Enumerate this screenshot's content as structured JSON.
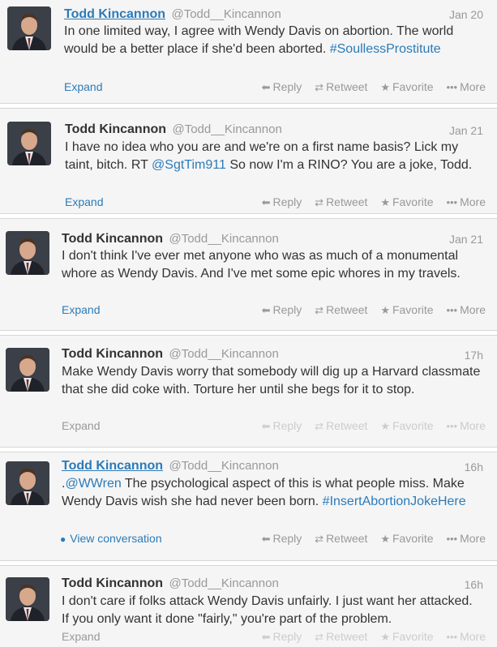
{
  "tweets": [
    {
      "name": "Todd Kincannon",
      "handle": "@Todd__Kincannon",
      "time": "Jan 20",
      "text_before": "In one limited way, I agree with Wendy Davis on abortion. The world would be a better place if she'd been aborted.",
      "text_link": "#SoullessProstitute",
      "text_after": "",
      "footer_link": "Expand",
      "actions": {
        "reply": "Reply",
        "retweet": "Retweet",
        "favorite": "Favorite",
        "more": "More"
      }
    },
    {
      "name": "Todd Kincannon",
      "handle": "@Todd__Kincannon",
      "time": "Jan 21",
      "text_before": "I have no idea who you are and we're on a first name basis? Lick my taint, bitch. RT",
      "text_link": "@SgtTim911",
      "text_after": "So now I'm a RINO? You are a joke, Todd.",
      "footer_link": "Expand",
      "actions": {
        "reply": "Reply",
        "retweet": "Retweet",
        "favorite": "Favorite",
        "more": "More"
      }
    },
    {
      "name": "Todd Kincannon",
      "handle": "@Todd__Kincannon",
      "time": "Jan 21",
      "text_before": "I don't think I've ever met anyone who was as much of a monumental whore as Wendy Davis. And I've met some epic whores in my travels.",
      "text_link": "",
      "text_after": "",
      "footer_link": "Expand",
      "actions": {
        "reply": "Reply",
        "retweet": "Retweet",
        "favorite": "Favorite",
        "more": "More"
      }
    },
    {
      "name": "Todd Kincannon",
      "handle": "@Todd__Kincannon",
      "time": "17h",
      "text_before": "Make Wendy Davis worry that somebody will dig up a Harvard classmate that she did coke with. Torture her until she begs for it to stop.",
      "text_link": "",
      "text_after": "",
      "footer_link": "Expand",
      "actions": {
        "reply": "Reply",
        "retweet": "Retweet",
        "favorite": "Favorite",
        "more": "More"
      }
    },
    {
      "name": "Todd Kincannon",
      "handle": "@Todd__Kincannon",
      "time": "16h",
      "text_prefix": ".",
      "text_prefix_link": "@WWren",
      "text_before": "The psychological aspect of this is what people miss. Make Wendy Davis wish she had never been born.",
      "text_link": "#InsertAbortionJokeHere",
      "text_after": "",
      "footer_link": "View conversation",
      "actions": {
        "reply": "Reply",
        "retweet": "Retweet",
        "favorite": "Favorite",
        "more": "More"
      }
    },
    {
      "name": "Todd Kincannon",
      "handle": "@Todd__Kincannon",
      "time": "16h",
      "text_before": "I don't care if folks attack Wendy Davis unfairly. I just want her attacked. If you only want it done \"fairly,\" you're part of the problem.",
      "text_link": "",
      "text_after": "",
      "footer_link": "Expand",
      "actions": {
        "reply": "Reply",
        "retweet": "Retweet",
        "favorite": "Favorite",
        "more": "More"
      }
    }
  ],
  "icons": {
    "reply": "reply-arrow-icon",
    "retweet": "retweet-icon",
    "favorite": "star-icon",
    "more": "ellipsis-icon",
    "conversation": "speech-bubble-icon"
  },
  "colors": {
    "link": "#2b7bb9",
    "muted": "#999999",
    "card_bg": "#f5f5f5",
    "text": "#333333"
  }
}
